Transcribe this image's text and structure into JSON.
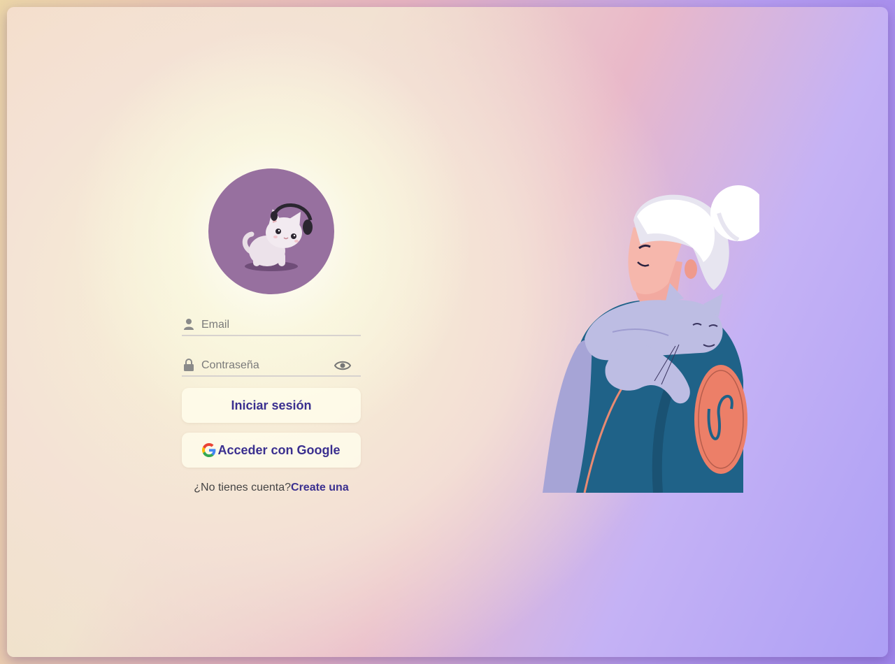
{
  "login": {
    "email_placeholder": "Email",
    "password_placeholder": "Contraseña",
    "login_button": "Iniciar sesión",
    "google_button": "Acceder con Google",
    "signup_prompt": "¿No tienes cuenta?",
    "signup_link": "Create una"
  },
  "icons": {
    "email": "user-icon",
    "password": "lock-icon",
    "toggle_password": "eye-icon",
    "google": "google-logo-icon"
  },
  "colors": {
    "avatar_background": "#97709f",
    "accent_text": "#3a2f8f",
    "button_background": "#fffdec"
  }
}
